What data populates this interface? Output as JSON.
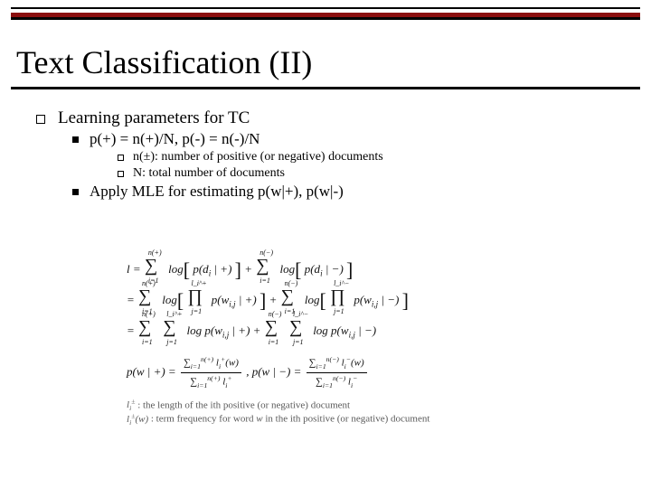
{
  "title": "Text Classification (II)",
  "body": {
    "lvl1": "Learning parameters for TC",
    "lvl2a": "p(+) = n(+)/N, p(-) = n(-)/N",
    "lvl3a": "n(±): number of positive (or negative) documents",
    "lvl3b": "N: total number of documents",
    "lvl2b": "Apply MLE for estimating p(w|+), p(w|-)"
  },
  "equations": {
    "l_line1_lhs": "l = ",
    "sum_np": "n(+)",
    "sum_nm": "n(−)",
    "sum_i1": "i=1",
    "log_pdi_pos": " log[ p(d_i | +) ] + ",
    "log_pdi_neg": " log[ p(d_i | −) ]",
    "prod_inner_pos": " p(w_{i,j} | +) ",
    "prod_inner_neg": " p(w_{i,j} | −) ",
    "li_plus": "l_i^+",
    "li_minus": "l_i^−",
    "j1": "j=1",
    "eq2_mid": " + ",
    "log_brL": "log",
    "pw_pos_lhs": "p(w | +) = ",
    "pw_neg_lhs": ",   p(w | −) = ",
    "frac_np_num": "Σ_{i=1}^{n(+)} l_i^+(w)",
    "frac_np_den": "Σ_{i=1}^{n(+)} l_i^+",
    "frac_nm_num": "Σ_{i=1}^{n(−)} l_i^−(w)",
    "frac_nm_den": "Σ_{i=1}^{n(−)} l_i^−",
    "gloss1": "l_i^± : the length of the ith positive (or negative) document",
    "gloss2": "l_i^±(w) : term frequency for word w in the ith positive (or negative) document"
  }
}
